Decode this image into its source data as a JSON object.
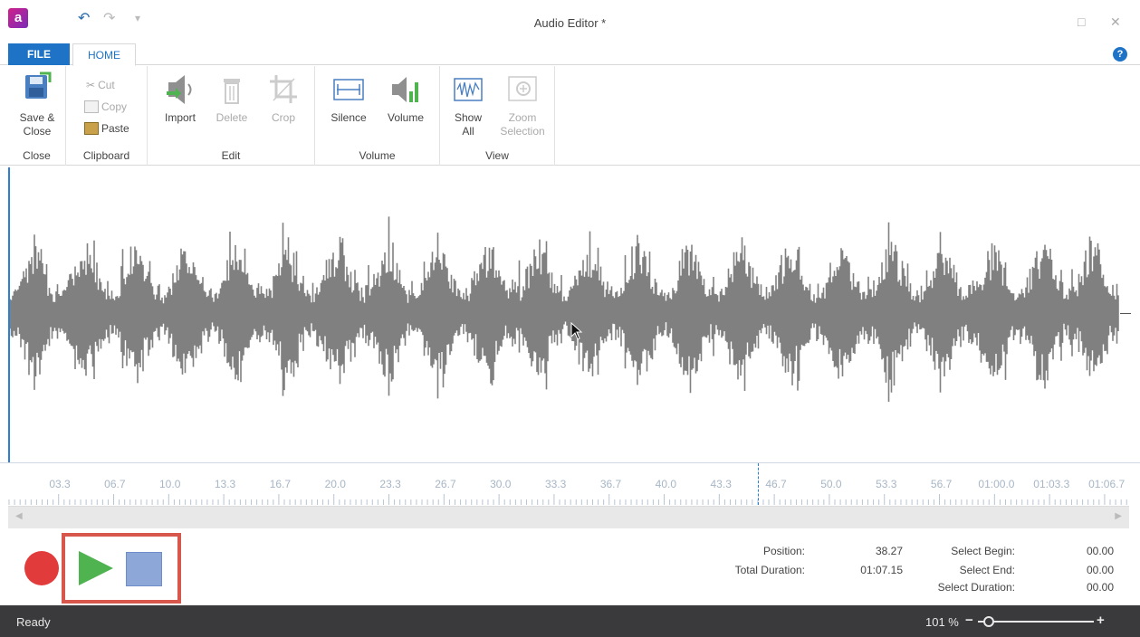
{
  "window": {
    "title": "Audio Editor *",
    "app_icon_letter": "a"
  },
  "tabs": {
    "file": "FILE",
    "home": "HOME"
  },
  "ribbon": {
    "close_group": {
      "label": "Close",
      "save_close": "Save &",
      "save_close_2": "Close"
    },
    "clipboard_group": {
      "label": "Clipboard",
      "cut": "Cut",
      "copy": "Copy",
      "paste": "Paste"
    },
    "edit_group": {
      "label": "Edit",
      "import": "Import",
      "delete": "Delete",
      "crop": "Crop"
    },
    "volume_group": {
      "label": "Volume",
      "silence": "Silence",
      "volume": "Volume"
    },
    "view_group": {
      "label": "View",
      "show_all_1": "Show",
      "show_all_2": "All",
      "zoom_sel_1": "Zoom",
      "zoom_sel_2": "Selection"
    }
  },
  "timeline": {
    "ticks": [
      "03.3",
      "06.7",
      "10.0",
      "13.3",
      "16.7",
      "20.0",
      "23.3",
      "26.7",
      "30.0",
      "33.3",
      "36.7",
      "40.0",
      "43.3",
      "46.7",
      "50.0",
      "53.3",
      "56.7",
      "01:00.0",
      "01:03.3",
      "01:06.7"
    ]
  },
  "info": {
    "position_label": "Position:",
    "position_value": "38.27",
    "total_duration_label": "Total Duration:",
    "total_duration_value": "01:07.15",
    "select_begin_label": "Select Begin:",
    "select_begin_value": "00.00",
    "select_end_label": "Select End:",
    "select_end_value": "00.00",
    "select_duration_label": "Select Duration:",
    "select_duration_value": "00.00"
  },
  "status": {
    "text": "Ready",
    "zoom_level": "101 %",
    "zoom_fraction": 0.05
  },
  "colors": {
    "accent": "#1e73c7",
    "waveform": "#808080",
    "record": "#e23b3b",
    "play": "#4fb34f",
    "stop": "#8ea7d9",
    "highlight": "#d8574c",
    "statusbar": "#3a3a3d"
  }
}
